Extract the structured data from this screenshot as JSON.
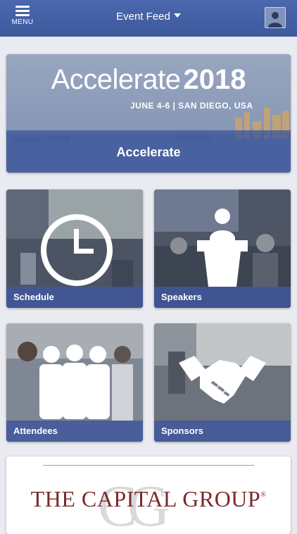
{
  "topbar": {
    "menu_label": "MENU",
    "title": "Event Feed"
  },
  "hero": {
    "brand_word": "Accelerate",
    "brand_year": "2018",
    "dates_location": "JUNE 4-6 | SAN DIEGO, USA",
    "label": "Accelerate"
  },
  "tiles": [
    {
      "label": "Schedule",
      "icon": "clock-icon"
    },
    {
      "label": "Speakers",
      "icon": "podium-speaker-icon"
    },
    {
      "label": "Attendees",
      "icon": "people-group-icon"
    },
    {
      "label": "Sponsors",
      "icon": "handshake-icon"
    }
  ],
  "sponsor": {
    "monogram": "CG",
    "name": "THE CAPITAL GROUP",
    "mark": "®"
  },
  "colors": {
    "topbar": "#4462a7",
    "overlay_bar": "#3f579b",
    "sponsor_text": "#7a2b2b"
  }
}
